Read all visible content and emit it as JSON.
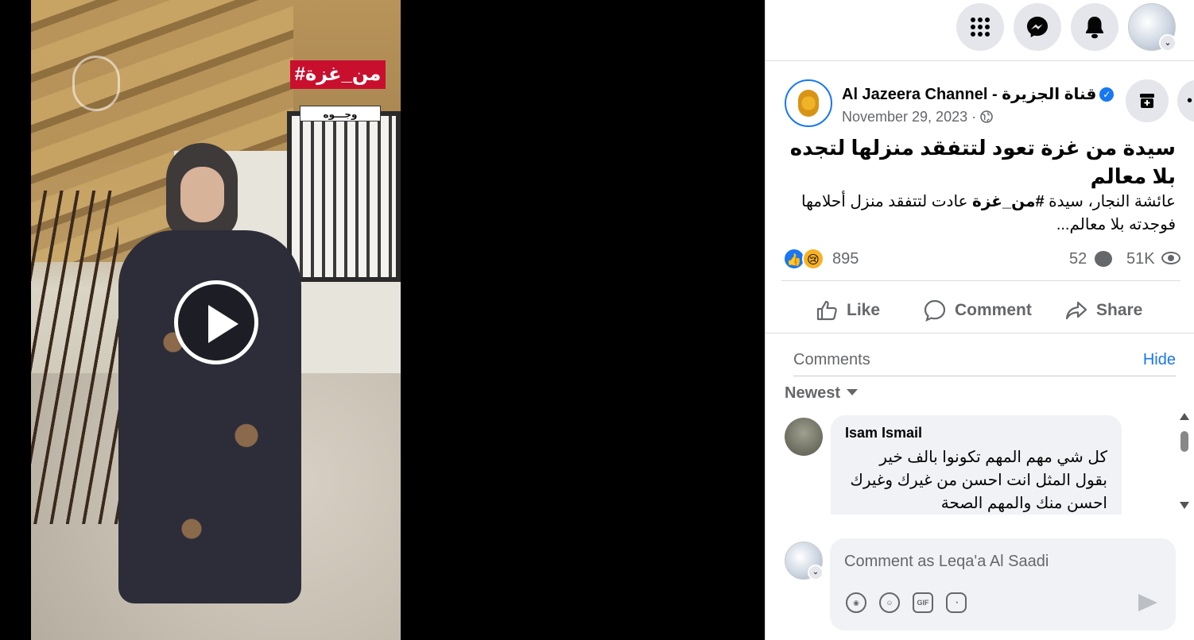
{
  "video": {
    "tag_main": "#من_غزة",
    "tag_sub": "وجـــوه"
  },
  "topbar": {
    "menu_icon": "grid-menu-icon",
    "messenger_icon": "messenger-icon",
    "notifications_icon": "bell-icon"
  },
  "post": {
    "page_name": "Al Jazeera Channel - قناة الجزيرة",
    "date": "November 29, 2023 ·",
    "title": "سيدة من غزة تعود لتتفقد منزلها لتجده بلا معالم",
    "body_prefix": "عائشة النجار، سيدة ",
    "body_hashtag": "#من_غزة",
    "body_suffix": " عادت لتتفقد منزل أحلامها فوجدته بلا معالم...",
    "reactions_count": "895",
    "comments_count": "52",
    "views_count": "51K"
  },
  "actions": {
    "like": "Like",
    "comment": "Comment",
    "share": "Share"
  },
  "comments": {
    "header": "Comments",
    "hide": "Hide",
    "sort": "Newest",
    "items": [
      {
        "author": "Isam Ismail",
        "text": "كل شي مهم المهم تكونوا بالف خير بقول المثل انت احسن من غيرك وغيرك احسن منك والمهم الصحة"
      }
    ]
  },
  "composer": {
    "placeholder": "Comment as Leqa'a Al Saadi",
    "gif_label": "GIF"
  },
  "colors": {
    "accent": "#1877f2",
    "muted": "#65676b",
    "surface": "#f0f2f5"
  }
}
